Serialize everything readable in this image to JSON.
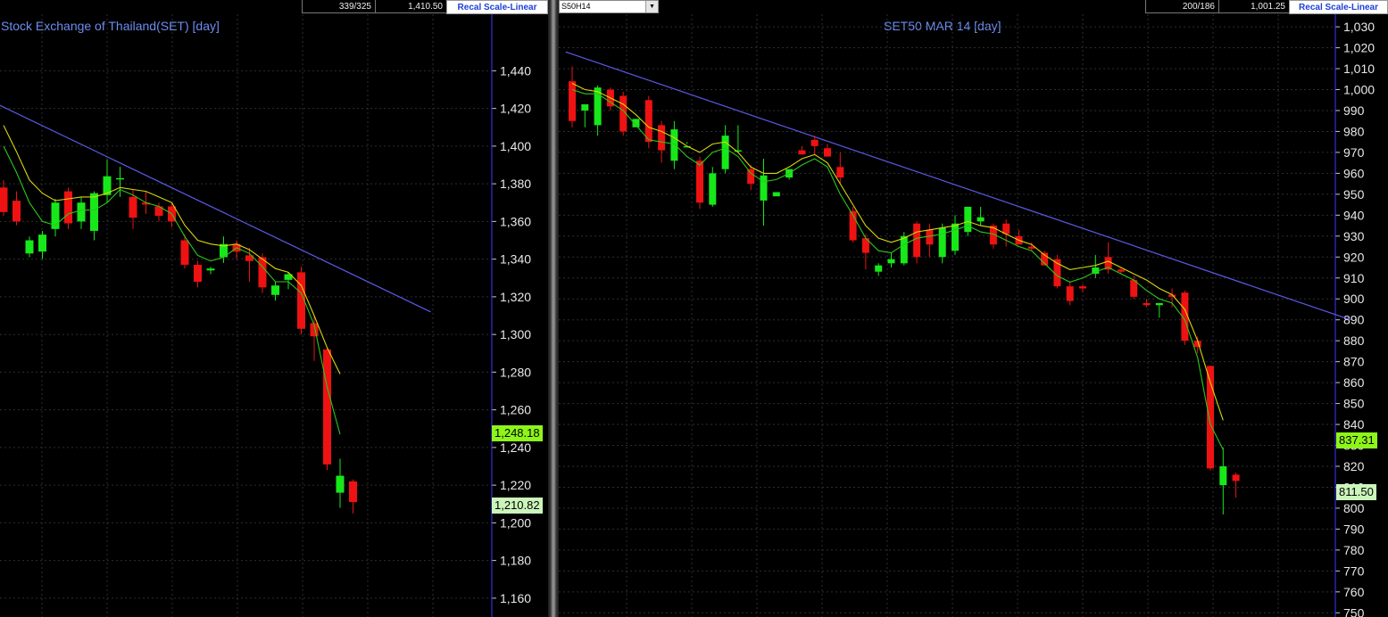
{
  "colors": {
    "up": "#17e81a",
    "down": "#ee1212",
    "ma_fast": "#2bc81c",
    "ma_slow": "#d8d80c",
    "trend": "#5a5ae6",
    "grid": "#2e2e2e",
    "axis": "#3a3aff",
    "label_close": "#ccf5bb",
    "label_ma": "#8ef51a"
  },
  "left": {
    "header": {
      "count": "339/325",
      "price": "1,410.50",
      "recal_label": "Recal Scale-Linear"
    },
    "title": "Stock Exchange of Thailand(SET)  [day]",
    "last_label": "1,210.82",
    "ma_label": "1,248.18"
  },
  "right": {
    "header": {
      "symbol": "S50H14",
      "count": "200/186",
      "price": "1,001.25",
      "recal_label": "Recal Scale-Linear"
    },
    "title": "SET50 MAR 14   [day]",
    "last_label": "811.50",
    "ma_label": "837.31"
  },
  "chart_data": [
    {
      "type": "candlestick",
      "title": "Stock Exchange of Thailand(SET)  [day]",
      "ylim": [
        1150,
        1470
      ],
      "yticks": [
        1160,
        1180,
        1200,
        1220,
        1240,
        1260,
        1280,
        1300,
        1320,
        1340,
        1360,
        1380,
        1400,
        1420,
        1440
      ],
      "tick_labels": [
        "1,160",
        "1,180",
        "1,200",
        "1,220",
        "1,240",
        "1,260",
        "1,280",
        "1,300",
        "1,320",
        "1,340",
        "1,360",
        "1,380",
        "1,400",
        "1,420",
        "1,440"
      ],
      "grid": true,
      "candles": [
        {
          "o": 1378,
          "h": 1382,
          "l": 1363,
          "c": 1365
        },
        {
          "o": 1371,
          "h": 1376,
          "l": 1358,
          "c": 1360
        },
        {
          "o": 1343,
          "h": 1352,
          "l": 1341,
          "c": 1350
        },
        {
          "o": 1344,
          "h": 1355,
          "l": 1340,
          "c": 1353
        },
        {
          "o": 1356,
          "h": 1372,
          "l": 1352,
          "c": 1370
        },
        {
          "o": 1376,
          "h": 1378,
          "l": 1356,
          "c": 1359
        },
        {
          "o": 1360,
          "h": 1373,
          "l": 1356,
          "c": 1370
        },
        {
          "o": 1355,
          "h": 1376,
          "l": 1350,
          "c": 1375
        },
        {
          "o": 1374,
          "h": 1393,
          "l": 1370,
          "c": 1384
        },
        {
          "o": 1383,
          "h": 1389,
          "l": 1373,
          "c": 1383
        },
        {
          "o": 1373,
          "h": 1377,
          "l": 1356,
          "c": 1362
        },
        {
          "o": 1370,
          "h": 1376,
          "l": 1364,
          "c": 1369
        },
        {
          "o": 1368,
          "h": 1370,
          "l": 1360,
          "c": 1363
        },
        {
          "o": 1368,
          "h": 1370,
          "l": 1357,
          "c": 1360
        },
        {
          "o": 1350,
          "h": 1353,
          "l": 1335,
          "c": 1337
        },
        {
          "o": 1337,
          "h": 1339,
          "l": 1325,
          "c": 1328
        },
        {
          "o": 1334,
          "h": 1336,
          "l": 1332,
          "c": 1335
        },
        {
          "o": 1341,
          "h": 1352,
          "l": 1338,
          "c": 1348
        },
        {
          "o": 1348,
          "h": 1350,
          "l": 1340,
          "c": 1344
        },
        {
          "o": 1342,
          "h": 1346,
          "l": 1328,
          "c": 1339
        },
        {
          "o": 1341,
          "h": 1343,
          "l": 1322,
          "c": 1325
        },
        {
          "o": 1321,
          "h": 1328,
          "l": 1318,
          "c": 1326
        },
        {
          "o": 1329,
          "h": 1333,
          "l": 1324,
          "c": 1332
        },
        {
          "o": 1333,
          "h": 1336,
          "l": 1300,
          "c": 1303
        },
        {
          "o": 1306,
          "h": 1310,
          "l": 1286,
          "c": 1299
        },
        {
          "o": 1292,
          "h": 1293,
          "l": 1228,
          "c": 1231
        },
        {
          "o": 1216,
          "h": 1234,
          "l": 1208,
          "c": 1225
        },
        {
          "o": 1222,
          "h": 1223,
          "l": 1205,
          "c": 1211
        }
      ],
      "ma_fast": [
        1400,
        1386,
        1370,
        1360,
        1358,
        1364,
        1366,
        1366,
        1370,
        1377,
        1374,
        1370,
        1368,
        1364,
        1352,
        1342,
        1339,
        1341,
        1346,
        1343,
        1336,
        1328,
        1328,
        1322,
        1305,
        1272,
        1247
      ],
      "ma_slow": [
        1411,
        1397,
        1382,
        1375,
        1371,
        1372,
        1373,
        1373,
        1375,
        1378,
        1377,
        1376,
        1373,
        1370,
        1358,
        1350,
        1348,
        1347,
        1348,
        1345,
        1340,
        1335,
        1333,
        1326,
        1310,
        1293,
        1279
      ],
      "trend_line": [
        [
          -1,
          1424
        ],
        [
          33,
          1312
        ]
      ]
    },
    {
      "type": "candlestick",
      "title": "SET50 MAR 14   [day]",
      "ylim": [
        748,
        1036
      ],
      "yticks": [
        750,
        760,
        770,
        780,
        790,
        800,
        810,
        820,
        830,
        840,
        850,
        860,
        870,
        880,
        890,
        900,
        910,
        920,
        930,
        940,
        950,
        960,
        970,
        980,
        990,
        1000,
        1010,
        1020,
        1030
      ],
      "tick_labels": [
        "750",
        "760",
        "770",
        "780",
        "790",
        "800",
        "810",
        "820",
        "830",
        "840",
        "850",
        "860",
        "870",
        "880",
        "890",
        "900",
        "910",
        "920",
        "930",
        "940",
        "950",
        "960",
        "970",
        "980",
        "990",
        "1,000",
        "1,010",
        "1,020",
        "1,030"
      ],
      "grid": true,
      "candles": [
        {
          "o": 1004,
          "h": 1011,
          "l": 982,
          "c": 985
        },
        {
          "o": 990,
          "h": 992,
          "l": 982,
          "c": 993
        },
        {
          "o": 983,
          "h": 1002,
          "l": 978,
          "c": 1001
        },
        {
          "o": 1000,
          "h": 1001,
          "l": 990,
          "c": 992
        },
        {
          "o": 997,
          "h": 999,
          "l": 978,
          "c": 980
        },
        {
          "o": 982,
          "h": 986,
          "l": 983,
          "c": 986
        },
        {
          "o": 995,
          "h": 997,
          "l": 972,
          "c": 975
        },
        {
          "o": 983,
          "h": 985,
          "l": 965,
          "c": 971
        },
        {
          "o": 966,
          "h": 985,
          "l": 962,
          "c": 981
        },
        {
          "o": 973,
          "h": 975,
          "l": 974,
          "c": 973
        },
        {
          "o": 966,
          "h": 968,
          "l": 943,
          "c": 946
        },
        {
          "o": 945,
          "h": 963,
          "l": 944,
          "c": 960
        },
        {
          "o": 962,
          "h": 983,
          "l": 960,
          "c": 978
        },
        {
          "o": 971,
          "h": 983,
          "l": 970,
          "c": 971
        },
        {
          "o": 962,
          "h": 964,
          "l": 952,
          "c": 955
        },
        {
          "o": 947,
          "h": 967,
          "l": 935,
          "c": 959
        },
        {
          "o": 949,
          "h": 951,
          "l": 951,
          "c": 951
        },
        {
          "o": 958,
          "h": 962,
          "l": 957,
          "c": 962
        },
        {
          "o": 971,
          "h": 973,
          "l": 969,
          "c": 969
        },
        {
          "o": 976,
          "h": 978,
          "l": 969,
          "c": 973
        },
        {
          "o": 972,
          "h": 974,
          "l": 968,
          "c": 968
        },
        {
          "o": 963,
          "h": 970,
          "l": 955,
          "c": 958
        },
        {
          "o": 942,
          "h": 944,
          "l": 927,
          "c": 928
        },
        {
          "o": 929,
          "h": 931,
          "l": 914,
          "c": 922
        },
        {
          "o": 913,
          "h": 917,
          "l": 911,
          "c": 916
        },
        {
          "o": 917,
          "h": 922,
          "l": 915,
          "c": 919
        },
        {
          "o": 917,
          "h": 932,
          "l": 916,
          "c": 930
        },
        {
          "o": 936,
          "h": 937,
          "l": 917,
          "c": 920
        },
        {
          "o": 933,
          "h": 936,
          "l": 920,
          "c": 926
        },
        {
          "o": 920,
          "h": 936,
          "l": 917,
          "c": 934
        },
        {
          "o": 923,
          "h": 940,
          "l": 921,
          "c": 936
        },
        {
          "o": 932,
          "h": 941,
          "l": 930,
          "c": 944
        },
        {
          "o": 937,
          "h": 944,
          "l": 935,
          "c": 939
        },
        {
          "o": 935,
          "h": 936,
          "l": 924,
          "c": 926
        },
        {
          "o": 936,
          "h": 938,
          "l": 925,
          "c": 931
        },
        {
          "o": 930,
          "h": 933,
          "l": 926,
          "c": 926
        },
        {
          "o": 925,
          "h": 927,
          "l": 923,
          "c": 924
        },
        {
          "o": 922,
          "h": 923,
          "l": 916,
          "c": 916
        },
        {
          "o": 919,
          "h": 921,
          "l": 905,
          "c": 906
        },
        {
          "o": 906,
          "h": 908,
          "l": 897,
          "c": 899
        },
        {
          "o": 906,
          "h": 907,
          "l": 903,
          "c": 905
        },
        {
          "o": 912,
          "h": 921,
          "l": 910,
          "c": 915
        },
        {
          "o": 920,
          "h": 927,
          "l": 912,
          "c": 914
        },
        {
          "o": 914,
          "h": 915,
          "l": 912,
          "c": 913
        },
        {
          "o": 909,
          "h": 911,
          "l": 900,
          "c": 901
        },
        {
          "o": 898,
          "h": 900,
          "l": 896,
          "c": 897
        },
        {
          "o": 897,
          "h": 898,
          "l": 891,
          "c": 898
        },
        {
          "o": 902,
          "h": 905,
          "l": 896,
          "c": 901
        },
        {
          "o": 903,
          "h": 904,
          "l": 878,
          "c": 880
        },
        {
          "o": 880,
          "h": 882,
          "l": 874,
          "c": 877
        },
        {
          "o": 868,
          "h": 868,
          "l": 818,
          "c": 819
        },
        {
          "o": 811,
          "h": 829,
          "l": 797,
          "c": 820
        },
        {
          "o": 816,
          "h": 817,
          "l": 805,
          "c": 813
        }
      ],
      "ma_fast": [
        1000,
        998,
        998,
        994,
        990,
        983,
        976,
        975,
        974,
        968,
        964,
        970,
        972,
        968,
        960,
        956,
        957,
        960,
        964,
        967,
        963,
        950,
        940,
        929,
        923,
        922,
        926,
        929,
        930,
        931,
        933,
        935,
        932,
        931,
        928,
        925,
        923,
        917,
        911,
        908,
        910,
        913,
        915,
        912,
        909,
        904,
        900,
        898,
        890,
        872,
        840,
        828
      ],
      "ma_slow": [
        1003,
        1000,
        999,
        996,
        993,
        988,
        982,
        980,
        977,
        973,
        970,
        974,
        975,
        970,
        963,
        960,
        960,
        963,
        967,
        969,
        965,
        955,
        945,
        935,
        929,
        927,
        929,
        932,
        933,
        934,
        935,
        937,
        935,
        934,
        931,
        928,
        926,
        921,
        917,
        914,
        915,
        916,
        918,
        915,
        912,
        909,
        905,
        902,
        895,
        880,
        860,
        842
      ],
      "trend_line": [
        [
          -0.5,
          1018
        ],
        [
          61,
          890
        ]
      ]
    }
  ]
}
